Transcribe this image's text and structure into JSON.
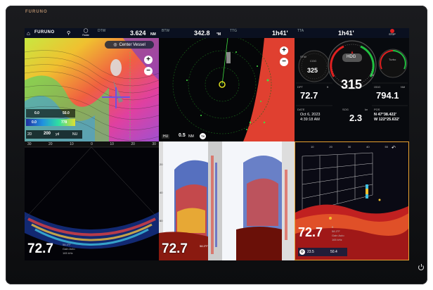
{
  "brand": "FURUNO",
  "topbar": {
    "home_icon": "home-icon",
    "furuno": "FURUNO",
    "pin_icon": "location-pin-icon",
    "radar_label": "Radar",
    "dtw_label": "DTW",
    "dtw_value": "3.624",
    "dtw_unit": "NM",
    "btw_label": "BTW",
    "btw_value": "342.8",
    "btw_unit": "°M",
    "ttg_label": "TTG",
    "ttg_value": "1h41'",
    "tta_label": "TTA",
    "tta_value": "1h41'",
    "stop_label": "STOP"
  },
  "chart_pane": {
    "center_vessel": "Center Vessel",
    "zoom_in": "+",
    "zoom_out": "−",
    "depth_min": "0.0",
    "depth_max": "50.0",
    "depth_val": "0.0",
    "depth_val2": "778",
    "scale_2d": "2D",
    "scale": "200",
    "scale_unit": "yd",
    "nu": "NU"
  },
  "radar_pane": {
    "zoom_in": "+",
    "zoom_out": "−",
    "hu": "HU",
    "range": "0.5",
    "range_unit": "NM",
    "tx": "TX"
  },
  "gauges_pane": {
    "cog_label": "COG",
    "cog_value": "325",
    "stw_label": "STW",
    "hdg_label": "HDG",
    "hdg_value": "315",
    "hdg_unit": "°M",
    "turbo_label": "Turbo",
    "dpt_label": "DPT",
    "dpt_value": "72.7",
    "dpt_unit": "ft",
    "odo_label": "ODO",
    "odo_value": "794.1",
    "odo_unit": "NM",
    "date_label": "DATE",
    "date_value": "Oct 6, 2023",
    "time_value": "4:39:18 AM",
    "sog_label": "SOG",
    "sog_value": "2.3",
    "sog_unit": "kn",
    "pos_label": "POS",
    "lat": "N 47°38.422'",
    "lon": "W 122°25.632'"
  },
  "sonar_pane": {
    "ticks": [
      "30",
      "20",
      "10",
      "0",
      "10",
      "20",
      "30"
    ],
    "side_ticks": [
      "10",
      "20",
      "30",
      "40",
      "50"
    ],
    "depth": "72.7",
    "info1": "58.3°F",
    "info2": "Gain Auto",
    "info3": "165 kHz"
  },
  "sounder_pane": {
    "depth": "72.7",
    "ticks": [
      "20",
      "40",
      "60",
      "80"
    ],
    "info": "58.3°F"
  },
  "threed_pane": {
    "ticks": [
      "10",
      "20",
      "30",
      "40",
      "50"
    ],
    "depth": "72.7",
    "info1": "ft",
    "info2": "58.3°F",
    "info3": "Gain Auto",
    "info4": "165 kHz",
    "temp": "23.5",
    "speed": "50.4"
  },
  "colors": {
    "accent": "#e8a030",
    "bezel": "#121315",
    "screen": "#000000"
  }
}
